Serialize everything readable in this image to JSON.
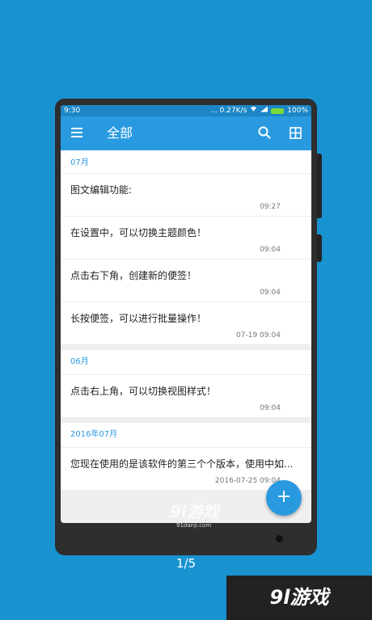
{
  "statusbar": {
    "time": "9:30",
    "speed": "... 0.27K/s",
    "battery": "100%"
  },
  "toolbar": {
    "title": "全部"
  },
  "groups": [
    {
      "header": "07月",
      "notes": [
        {
          "text": "图文编辑功能:",
          "time": "09:27"
        },
        {
          "text": "在设置中，可以切换主题颜色！",
          "time": "09:04"
        },
        {
          "text": "点击右下角，创建新的便签！",
          "time": "09:04"
        },
        {
          "text": "长按便签，可以进行批量操作！",
          "time": "07-19 09:04"
        }
      ]
    },
    {
      "header": "06月",
      "notes": [
        {
          "text": "点击右上角，可以切换视图样式！",
          "time": "09:04"
        }
      ]
    },
    {
      "header": "2016年07月",
      "notes": [
        {
          "text": "您现在使用的是该软件的第三个个版本，使用中如...",
          "time": "2016-07-25 09:04"
        }
      ]
    }
  ],
  "fab": {
    "label": "+"
  },
  "pager": {
    "indicator": "1/5"
  },
  "watermark": {
    "logo": "9l游戏",
    "sub": "91danji.com",
    "corner": "9l游戏"
  },
  "colors": {
    "accent": "#2a9ae0",
    "background": "#1893d0"
  }
}
